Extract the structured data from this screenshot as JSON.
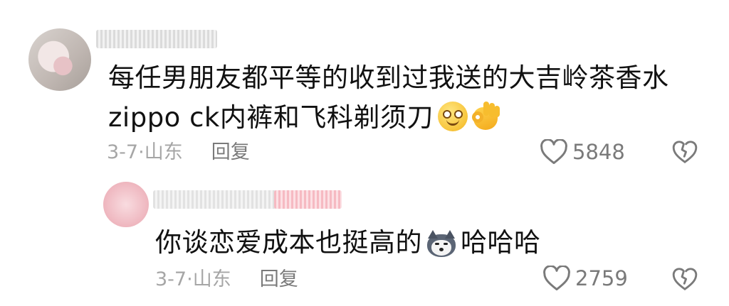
{
  "comments": [
    {
      "text_line1": "每任男朋友都平等的收到过我送的大吉岭茶香水",
      "text_line2": "zippo ck内裤和飞科剃须刀",
      "emojis": [
        "dizzy-smile-emoji",
        "ok-hand-emoji"
      ],
      "date": "3-7",
      "location": "山东",
      "reply_label": "回复",
      "likes": "5848"
    },
    {
      "text_prefix": "你谈恋爱成本也挺高的",
      "emoji": "husky-dog-emoji",
      "text_suffix": "哈哈哈",
      "date": "3-7",
      "location": "山东",
      "reply_label": "回复",
      "likes": "2759"
    }
  ],
  "icons": {
    "like": "heart-outline-icon",
    "dislike": "broken-heart-outline-icon"
  },
  "colors": {
    "text": "#111111",
    "meta": "#a6a6a6",
    "action": "#7a7a7a",
    "background": "#ffffff"
  }
}
